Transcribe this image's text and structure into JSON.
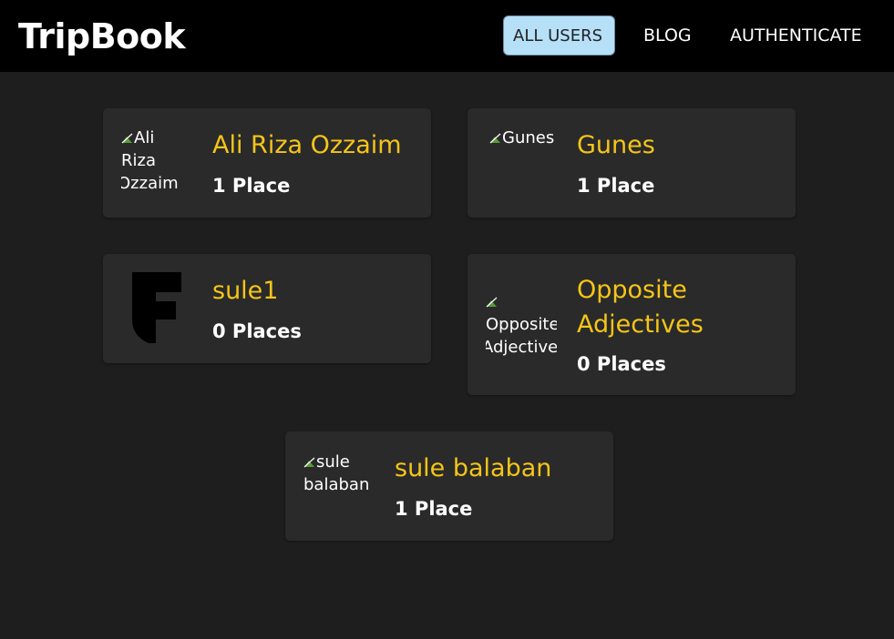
{
  "app": {
    "title": "TripBook"
  },
  "nav": {
    "all_users": "ALL USERS",
    "blog": "BLOG",
    "authenticate": "AUTHENTICATE"
  },
  "colors": {
    "header_bg": "#000000",
    "page_bg": "#1e1e1e",
    "card_bg": "#2a2a2a",
    "name_color": "#f5c518",
    "active_nav_bg": "#b6e0f8"
  },
  "users": [
    {
      "name": "Ali Riza Ozzaim",
      "places": "1 Place",
      "avatar_alt_1": "Ali",
      "avatar_alt_2": "Riza",
      "avatar_alt_3": "Ozzaim"
    },
    {
      "name": "Gunes",
      "places": "1 Place",
      "avatar_alt_1": "Gunes"
    },
    {
      "name": "sule1",
      "places": "0 Places",
      "avatar_letter": "F"
    },
    {
      "name_line1": "Opposite",
      "name_line2": "Adjectives",
      "places": "0 Places",
      "avatar_alt_1": "Opposite",
      "avatar_alt_2": "Adjectives"
    },
    {
      "name": "sule balaban",
      "places": "1 Place",
      "avatar_alt_1": "sule",
      "avatar_alt_2": "balaban"
    }
  ]
}
